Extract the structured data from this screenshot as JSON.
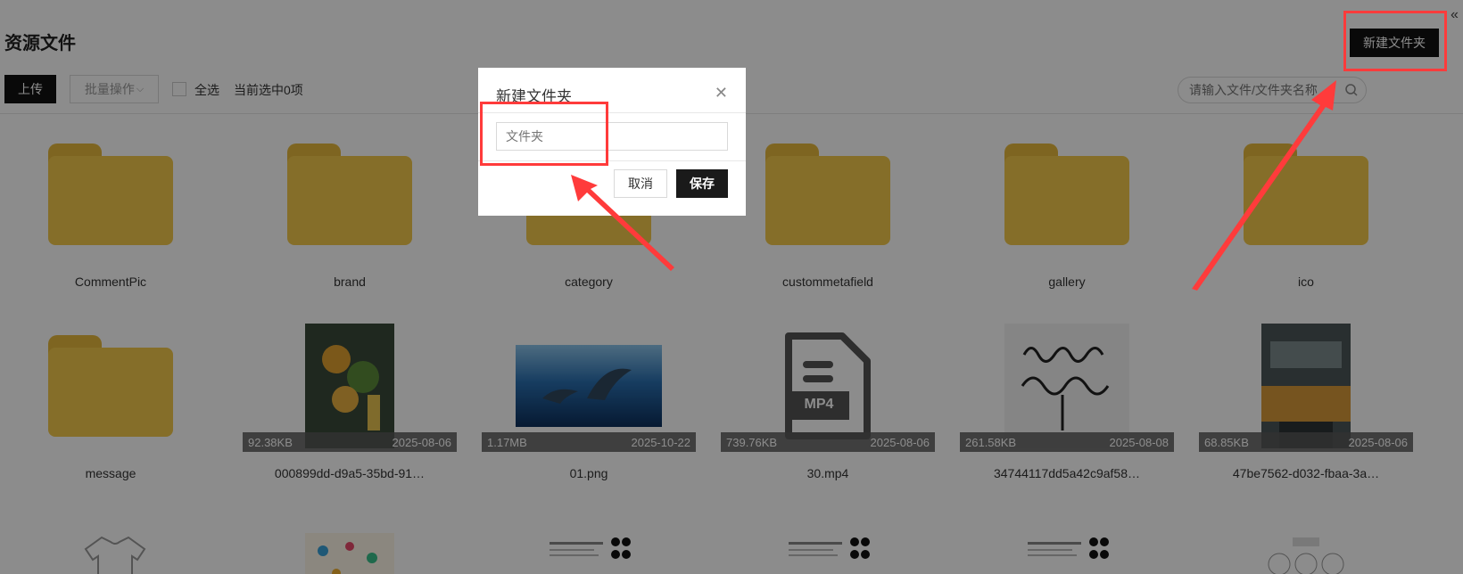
{
  "header": {
    "title": "资源文件",
    "new_folder_label": "新建文件夹",
    "collapse_glyph": "«"
  },
  "toolbar": {
    "upload_label": "上传",
    "batch_label": "批量操作",
    "select_all_label": "全选",
    "selected_count_label": "当前选中0项",
    "search_placeholder": "请输入文件/文件夹名称"
  },
  "items": [
    {
      "type": "folder",
      "name": "CommentPic"
    },
    {
      "type": "folder",
      "name": "brand"
    },
    {
      "type": "folder",
      "name": "category"
    },
    {
      "type": "folder",
      "name": "custommetafield"
    },
    {
      "type": "folder",
      "name": "gallery"
    },
    {
      "type": "folder",
      "name": "ico"
    },
    {
      "type": "folder",
      "name": "message"
    },
    {
      "type": "image",
      "name": "000899dd-d9a5-35bd-91…",
      "size": "92.38KB",
      "date": "2025-08-06"
    },
    {
      "type": "image",
      "name": "01.png",
      "size": "1.17MB",
      "date": "2025-10-22"
    },
    {
      "type": "video",
      "name": "30.mp4",
      "size": "739.76KB",
      "date": "2025-08-06",
      "badge": "MP4"
    },
    {
      "type": "image",
      "name": "34744117dd5a42c9af58…",
      "size": "261.58KB",
      "date": "2025-08-08"
    },
    {
      "type": "image",
      "name": "47be7562-d032-fbaa-3a…",
      "size": "68.85KB",
      "date": "2025-08-06"
    }
  ],
  "dialog": {
    "title": "新建文件夹",
    "input_placeholder": "文件夹",
    "cancel_label": "取消",
    "save_label": "保存"
  },
  "colors": {
    "folder": "#f3c84b",
    "primary_button": "#111111",
    "highlight": "#ff3b3b"
  }
}
